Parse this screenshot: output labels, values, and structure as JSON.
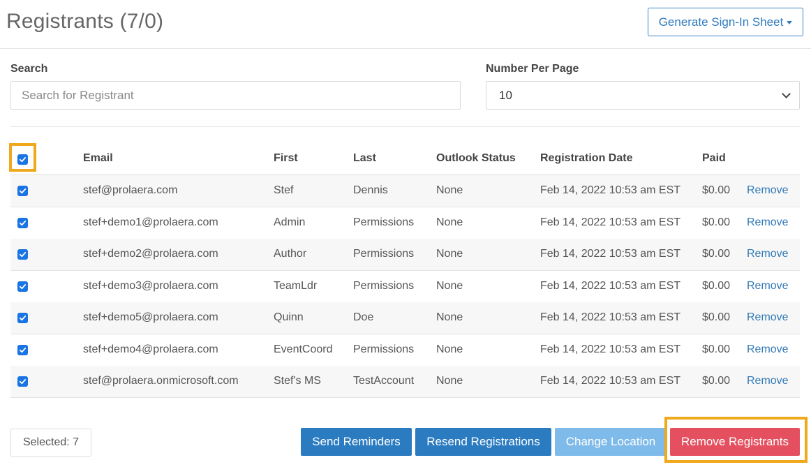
{
  "header": {
    "title": "Registrants (7/0)",
    "generate_button": "Generate Sign-In Sheet"
  },
  "filters": {
    "search_label": "Search",
    "search_placeholder": "Search for Registrant",
    "search_value": "",
    "per_page_label": "Number Per Page",
    "per_page_value": "10"
  },
  "table": {
    "columns": [
      "Email",
      "First",
      "Last",
      "Outlook Status",
      "Registration Date",
      "Paid"
    ],
    "select_all_checked": true,
    "action_label": "Remove",
    "rows": [
      {
        "email": "stef@prolaera.com",
        "first": "Stef",
        "last": "Dennis",
        "status": "None",
        "date": "Feb 14, 2022 10:53 am EST",
        "paid": "$0.00",
        "checked": true
      },
      {
        "email": "stef+demo1@prolaera.com",
        "first": "Admin",
        "last": "Permissions",
        "status": "None",
        "date": "Feb 14, 2022 10:53 am EST",
        "paid": "$0.00",
        "checked": true
      },
      {
        "email": "stef+demo2@prolaera.com",
        "first": "Author",
        "last": "Permissions",
        "status": "None",
        "date": "Feb 14, 2022 10:53 am EST",
        "paid": "$0.00",
        "checked": true
      },
      {
        "email": "stef+demo3@prolaera.com",
        "first": "TeamLdr",
        "last": "Permissions",
        "status": "None",
        "date": "Feb 14, 2022 10:53 am EST",
        "paid": "$0.00",
        "checked": true
      },
      {
        "email": "stef+demo5@prolaera.com",
        "first": "Quinn",
        "last": "Doe",
        "status": "None",
        "date": "Feb 14, 2022 10:53 am EST",
        "paid": "$0.00",
        "checked": true
      },
      {
        "email": "stef+demo4@prolaera.com",
        "first": "EventCoord",
        "last": "Permissions",
        "status": "None",
        "date": "Feb 14, 2022 10:53 am EST",
        "paid": "$0.00",
        "checked": true
      },
      {
        "email": "stef@prolaera.onmicrosoft.com",
        "first": "Stef's MS",
        "last": "TestAccount",
        "status": "None",
        "date": "Feb 14, 2022 10:53 am EST",
        "paid": "$0.00",
        "checked": true
      }
    ]
  },
  "footer": {
    "selected_text": "Selected: 7",
    "send_reminders": "Send Reminders",
    "resend_registrations": "Resend Registrations",
    "change_location": "Change Location",
    "remove_registrants": "Remove Registrants"
  },
  "colors": {
    "primary": "#2b7bc0",
    "disabled": "#7fbbea",
    "danger": "#e4505f",
    "highlight": "#f0a81c",
    "checkbox": "#1b74e4"
  },
  "icons": {
    "checkbox": "checkmark-icon",
    "dropdown": "chevron-down-icon",
    "caret": "caret-down-icon"
  }
}
